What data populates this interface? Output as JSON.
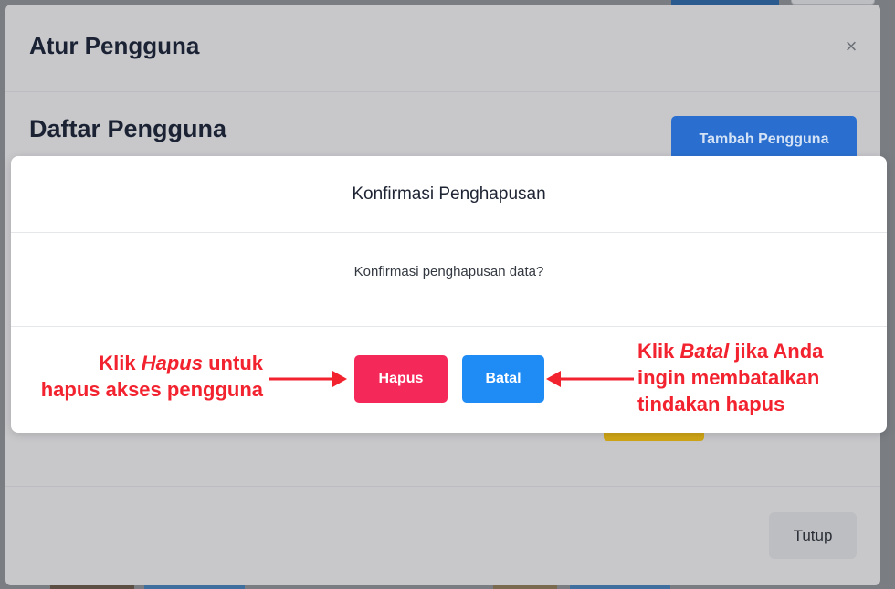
{
  "outer_modal": {
    "title": "Atur Pengguna",
    "close_glyph": "×",
    "subtitle": "Daftar Pengguna",
    "add_button": "Tambah Pengguna",
    "close_button": "Tutup"
  },
  "dialog": {
    "title": "Konfirmasi Penghapusan",
    "message": "Konfirmasi penghapusan data?",
    "delete_button": "Hapus",
    "cancel_button": "Batal"
  },
  "annotations": {
    "left": {
      "prefix": "Klik ",
      "emphasis": "Hapus",
      "suffix": " untuk",
      "line2": "hapus akses pengguna"
    },
    "right": {
      "prefix": "Klik ",
      "emphasis": "Batal",
      "suffix": " jika Anda",
      "line2": "ingin membatalkan",
      "line3": "tindakan hapus"
    }
  },
  "colors": {
    "delete": "#f5285a",
    "cancel": "#1f8bf4",
    "annotation": "#f2222f"
  }
}
